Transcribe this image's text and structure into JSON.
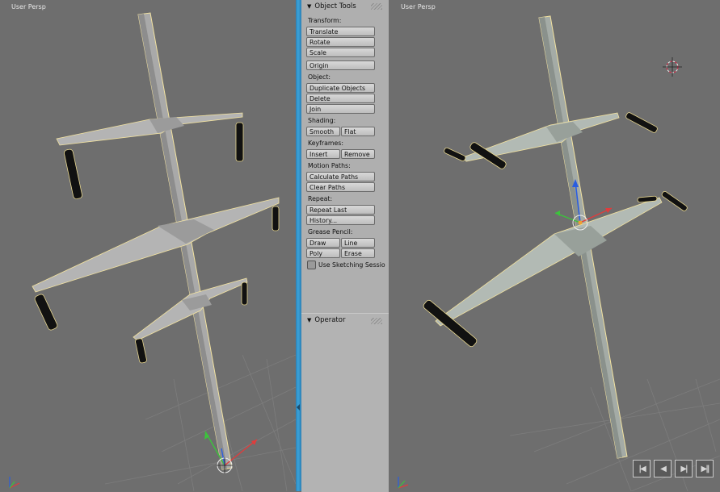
{
  "left_viewport": {
    "title": "User Persp"
  },
  "right_viewport": {
    "title": "User Persp"
  },
  "toolshelf": {
    "object_tools": {
      "header": "Object Tools",
      "transform": {
        "label": "Transform:",
        "translate": "Translate",
        "rotate": "Rotate",
        "scale": "Scale",
        "origin": "Origin"
      },
      "object": {
        "label": "Object:",
        "duplicate": "Duplicate Objects",
        "delete": "Delete",
        "join": "Join"
      },
      "shading": {
        "label": "Shading:",
        "smooth": "Smooth",
        "flat": "Flat"
      },
      "keyframes": {
        "label": "Keyframes:",
        "insert": "Insert",
        "remove": "Remove"
      },
      "motion_paths": {
        "label": "Motion Paths:",
        "calculate": "Calculate Paths",
        "clear": "Clear Paths"
      },
      "repeat": {
        "label": "Repeat:",
        "repeat_last": "Repeat Last",
        "history": "History..."
      },
      "grease_pencil": {
        "label": "Grease Pencil:",
        "draw": "Draw",
        "line": "Line",
        "poly": "Poly",
        "erase": "Erase",
        "sketching": "Use Sketching Sessio",
        "sketching_checked": false
      }
    },
    "operator": {
      "header": "Operator"
    }
  },
  "colors": {
    "divider": "#3399cc",
    "viewport_bg": "#6e6e6e",
    "toolshelf_bg": "#afafaf",
    "selection_outline": "#ffd24a",
    "axis_x": "#e03c3c",
    "axis_y": "#3cc43c",
    "axis_z": "#2a5de0"
  },
  "icons": [
    "axis-gizmo-icon",
    "3d-cursor-icon",
    "jump-start-icon",
    "step-back-icon",
    "step-forward-icon",
    "jump-end-icon"
  ]
}
